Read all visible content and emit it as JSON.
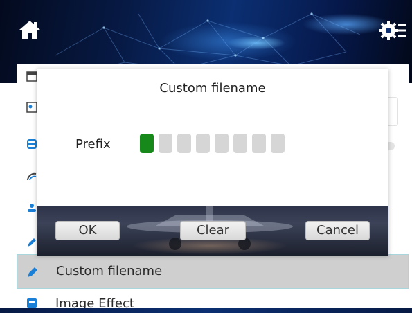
{
  "header": {
    "home_icon": "home-icon",
    "settings_icon": "settings-menu-icon"
  },
  "dialog": {
    "title": "Custom filename",
    "prefix_label": "Prefix",
    "prefix_slot_count": 8,
    "active_slot_index": 0,
    "buttons": {
      "ok": "OK",
      "clear": "Clear",
      "cancel": "Cancel"
    }
  },
  "list": {
    "icons": [
      "calendar-icon",
      "id-card-icon",
      "storage-icon",
      "signal-icon",
      "user-icon",
      "pen-icon"
    ],
    "selected_item": {
      "icon": "pen-icon",
      "label": "Custom filename"
    },
    "next_item": {
      "icon": "image-icon",
      "label": "Image Effect"
    }
  },
  "colors": {
    "accent_green": "#17891a",
    "slot_inactive": "#d6d6d6",
    "icon_blue": "#1a7fd6",
    "selected_row_bg": "#cfcfcf"
  }
}
